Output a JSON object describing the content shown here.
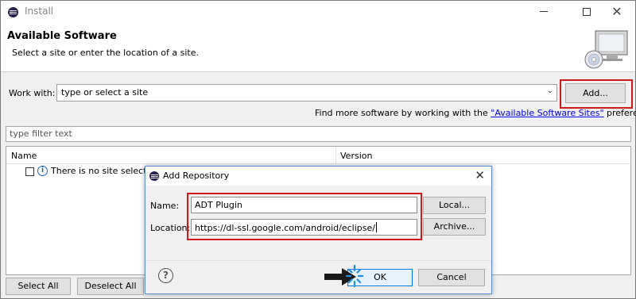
{
  "window": {
    "title": "Install",
    "header_title": "Available Software",
    "header_subtitle": "Select a site or enter the location of a site.",
    "banner_icon": "install-cd-monitor-icon"
  },
  "work_with": {
    "label": "Work with:",
    "placeholder": "type or select a site",
    "add_label": "Add..."
  },
  "find_more": {
    "prefix": "Find more software by working with the ",
    "link": "\"Available Software Sites\"",
    "suffix": " preferences."
  },
  "filter": {
    "placeholder": "type filter text"
  },
  "table": {
    "columns": [
      "Name",
      "Version"
    ],
    "rows": [
      {
        "name": "There is no site selected.",
        "checked": false,
        "icon": "info-icon"
      }
    ]
  },
  "buttons": {
    "select_all": "Select All",
    "deselect_all": "Deselect All"
  },
  "dialog": {
    "title": "Add Repository",
    "name_label": "Name:",
    "name_value": "ADT Plugin",
    "local_label": "Local...",
    "location_label": "Location:",
    "location_value": "https://dl-ssl.google.com/android/eclipse/",
    "archive_label": "Archive...",
    "ok_label": "OK",
    "cancel_label": "Cancel",
    "help_glyph": "?"
  },
  "colors": {
    "highlight": "#d01818",
    "link": "#0000ee",
    "default_button_border": "#0078d7"
  }
}
